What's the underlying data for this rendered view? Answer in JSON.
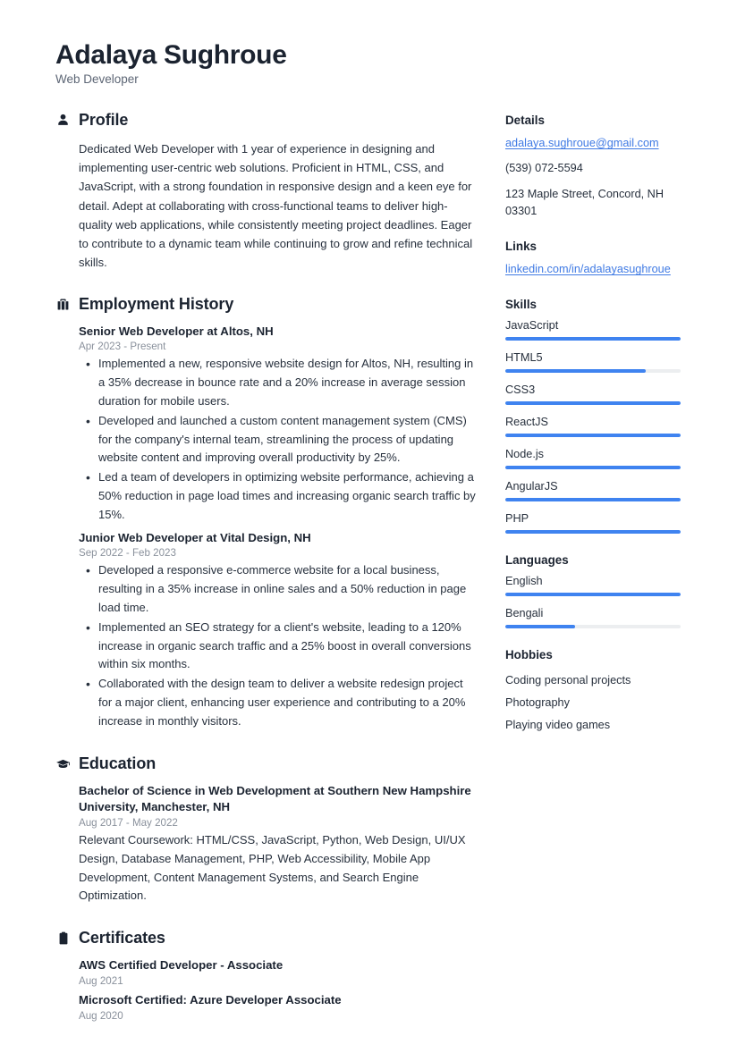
{
  "header": {
    "full_name": "Adalaya Sughroue",
    "job_title": "Web Developer"
  },
  "accent_color": "#3f83f0",
  "link_color": "#3f7ae4",
  "sections": {
    "profile": {
      "title": "Profile",
      "icon": "user-icon",
      "text": "Dedicated Web Developer with 1 year of experience in designing and implementing user-centric web solutions. Proficient in HTML, CSS, and JavaScript, with a strong foundation in responsive design and a keen eye for detail. Adept at collaborating with cross-functional teams to deliver high-quality web applications, while consistently meeting project deadlines. Eager to contribute to a dynamic team while continuing to grow and refine technical skills."
    },
    "employment": {
      "title": "Employment History",
      "icon": "briefcase-icon",
      "entries": [
        {
          "title": "Senior Web Developer at Altos, NH",
          "date": "Apr 2023 - Present",
          "bullets": [
            "Implemented a new, responsive website design for Altos, NH, resulting in a 35% decrease in bounce rate and a 20% increase in average session duration for mobile users.",
            "Developed and launched a custom content management system (CMS) for the company's internal team, streamlining the process of updating website content and improving overall productivity by 25%.",
            "Led a team of developers in optimizing website performance, achieving a 50% reduction in page load times and increasing organic search traffic by 15%."
          ]
        },
        {
          "title": "Junior Web Developer at Vital Design, NH",
          "date": "Sep 2022 - Feb 2023",
          "bullets": [
            "Developed a responsive e-commerce website for a local business, resulting in a 35% increase in online sales and a 50% reduction in page load time.",
            "Implemented an SEO strategy for a client's website, leading to a 120% increase in organic search traffic and a 25% boost in overall conversions within six months.",
            "Collaborated with the design team to deliver a website redesign project for a major client, enhancing user experience and contributing to a 20% increase in monthly visitors."
          ]
        }
      ]
    },
    "education": {
      "title": "Education",
      "icon": "graduation-cap-icon",
      "entries": [
        {
          "title": "Bachelor of Science in Web Development at Southern New Hampshire University, Manchester, NH",
          "date": "Aug 2017 - May 2022",
          "description": "Relevant Coursework: HTML/CSS, JavaScript, Python, Web Design, UI/UX Design, Database Management, PHP, Web Accessibility, Mobile App Development, Content Management Systems, and Search Engine Optimization."
        }
      ]
    },
    "certificates": {
      "title": "Certificates",
      "icon": "clipboard-icon",
      "entries": [
        {
          "title": "AWS Certified Developer - Associate",
          "date": "Aug 2021"
        },
        {
          "title": "Microsoft Certified: Azure Developer Associate",
          "date": "Aug 2020"
        }
      ]
    }
  },
  "sidebar": {
    "details": {
      "title": "Details",
      "email": "adalaya.sughroue@gmail.com",
      "phone": "(539) 072-5594",
      "address": "123 Maple Street, Concord, NH 03301"
    },
    "links": {
      "title": "Links",
      "items": [
        {
          "label": "linkedin.com/in/adalayasughroue"
        }
      ]
    },
    "skills": {
      "title": "Skills",
      "items": [
        {
          "label": "JavaScript",
          "level": 100
        },
        {
          "label": "HTML5",
          "level": 80
        },
        {
          "label": "CSS3",
          "level": 100
        },
        {
          "label": "ReactJS",
          "level": 100
        },
        {
          "label": "Node.js",
          "level": 100
        },
        {
          "label": "AngularJS",
          "level": 100
        },
        {
          "label": "PHP",
          "level": 100
        }
      ]
    },
    "languages": {
      "title": "Languages",
      "items": [
        {
          "label": "English",
          "level": 100
        },
        {
          "label": "Bengali",
          "level": 40
        }
      ]
    },
    "hobbies": {
      "title": "Hobbies",
      "items": [
        {
          "label": "Coding personal projects"
        },
        {
          "label": "Photography"
        },
        {
          "label": "Playing video games"
        }
      ]
    }
  }
}
